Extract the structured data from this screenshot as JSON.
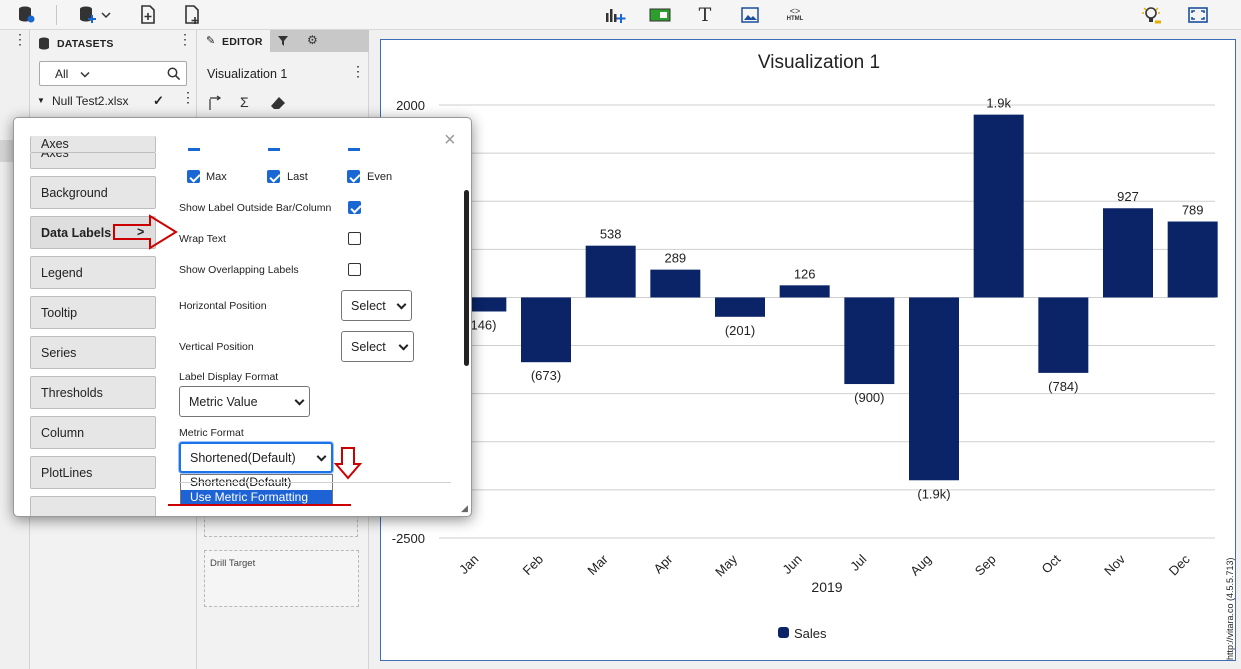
{
  "toolbar": {
    "left_icons": [
      "database-icon",
      "add-database-icon",
      "new-page-icon",
      "new-doc-icon"
    ],
    "center_icons": [
      "add-chart-icon",
      "panel-icon",
      "text-icon",
      "image-icon",
      "html-icon"
    ],
    "html_label": "HTML"
  },
  "datasets": {
    "title": "DATASETS",
    "filter_value": "All",
    "item": "Null Test2.xlsx"
  },
  "editor": {
    "tab_label": "EDITOR",
    "viz_name": "Visualization 1",
    "drill_target": "Drill Target"
  },
  "modal": {
    "nav": [
      "Axes",
      "Background",
      "Data Labels",
      "Legend",
      "Tooltip",
      "Series",
      "Thresholds",
      "Column",
      "PlotLines"
    ],
    "active_nav_arrow": ">",
    "close": "×",
    "checks": {
      "max": "Max",
      "last": "Last",
      "even": "Even"
    },
    "show_outside": "Show Label Outside Bar/Column",
    "wrap_text": "Wrap Text",
    "overlap": "Show Overlapping Labels",
    "hpos_label": "Horizontal Position",
    "hpos_value": "Select",
    "vpos_label": "Vertical Position",
    "vpos_value": "Select",
    "disp_format_label": "Label Display Format",
    "disp_format_value": "Metric Value",
    "metric_format_label": "Metric Format",
    "metric_format_value": "Shortened(Default)",
    "options": [
      "Shortened(Default)",
      "Use Metric Formatting"
    ]
  },
  "colors": {
    "bar": "#0b2468",
    "accent": "#1967d2",
    "annotation": "#cc0000"
  },
  "watermark": "http://vitara.co (4.5.5.713)",
  "chart_data": {
    "type": "bar",
    "title": "Visualization 1",
    "xlabel": "2019",
    "ylabel": "",
    "categories": [
      "Jan",
      "Feb",
      "Mar",
      "Apr",
      "May",
      "Jun",
      "Jul",
      "Aug",
      "Sep",
      "Oct",
      "Nov",
      "Dec"
    ],
    "series": [
      {
        "name": "Sales",
        "values": [
          -146,
          -673,
          538,
          289,
          -201,
          126,
          -900,
          -1900,
          1900,
          -784,
          927,
          789
        ]
      }
    ],
    "data_labels": [
      "(146)",
      "(673)",
      "538",
      "289",
      "(201)",
      "126",
      "(900)",
      "(1.9k)",
      "1.9k",
      "(784)",
      "927",
      "789"
    ],
    "y_tick_labels": [
      "2000",
      "-2500"
    ],
    "ylim": [
      -2500,
      2000
    ],
    "grid": true,
    "legend": "bottom"
  }
}
